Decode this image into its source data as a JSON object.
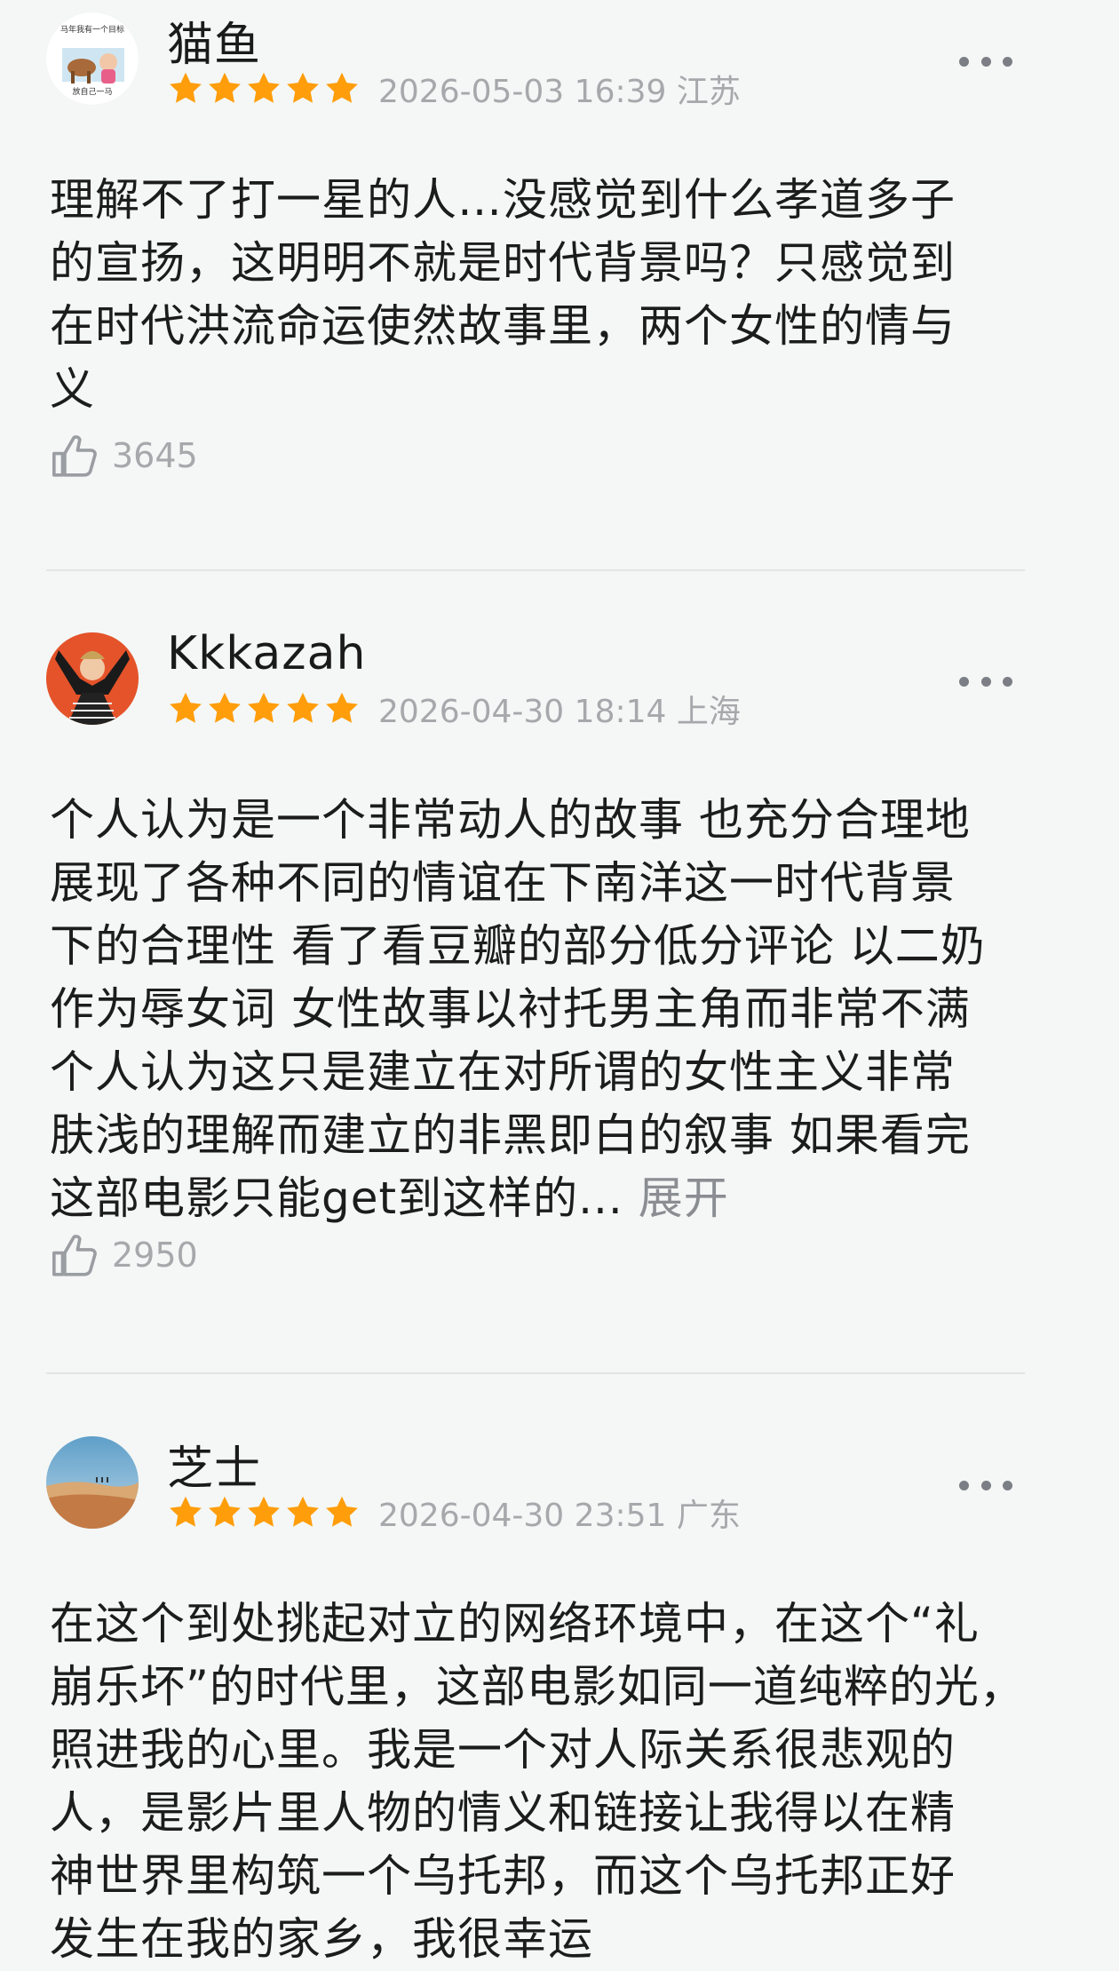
{
  "reviews": [
    {
      "username": "猫鱼",
      "avatar_text": [
        "马年我有一个目标",
        "放自己一马"
      ],
      "stars": 5,
      "meta": "2026-05-03 16:39 江苏",
      "text_lines": [
        "理解不了打一星的人…没感觉到什么孝道多子",
        "的宣扬，这明明不就是时代背景吗？只感觉到",
        "在时代洪流命运使然故事里，两个女性的情与",
        "义"
      ],
      "likes": "3645"
    },
    {
      "username": "Kkkazah",
      "stars": 5,
      "meta": "2026-04-30 18:14 上海",
      "text_lines": [
        "个人认为是一个非常动人的故事 也充分合理地",
        "展现了各种不同的情谊在下南洋这一时代背景",
        "下的合理性 看了看豆瓣的部分低分评论 以二奶",
        "作为辱女词 女性故事以衬托男主角而非常不满",
        "个人认为这只是建立在对所谓的女性主义非常",
        "肤浅的理解而建立的非黑即白的叙事  如果看完",
        "这部电影只能get到这样的..."
      ],
      "expand_label": "展开",
      "likes": "2950"
    },
    {
      "username": "芝士",
      "stars": 5,
      "meta": "2026-04-30 23:51 广东",
      "text_lines": [
        "在这个到处挑起对立的网络环境中，在这个“礼",
        "崩乐坏”的时代里，这部电影如同一道纯粹的光，",
        "照进我的心里。我是一个对人际关系很悲观的",
        "人，是影片里人物的情义和链接让我得以在精",
        "神世界里构筑一个乌托邦，而这个乌托邦正好",
        "发生在我的家乡，我很幸运"
      ]
    }
  ],
  "colors": {
    "star": "#ff9d0a",
    "background": "#f4f7f6",
    "meta": "#a6a8ab"
  },
  "icons": {
    "more": "more-dots-icon",
    "like": "thumbs-up-icon",
    "star": "star-icon"
  }
}
